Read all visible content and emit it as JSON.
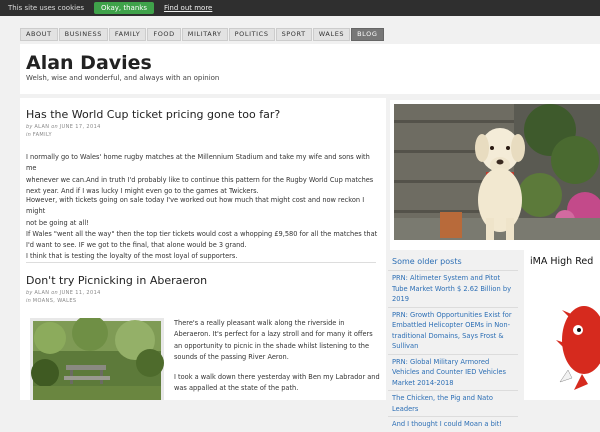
{
  "cookie_bar": {
    "message": "This site uses cookies",
    "ok_button": "Okay, thanks",
    "find_out_link": "Find out more"
  },
  "nav": {
    "items": [
      "ABOUT",
      "BUSINESS",
      "FAMILY",
      "FOOD",
      "MILITARY",
      "POLITICS",
      "SPORT",
      "WALES",
      "BLOG"
    ],
    "active": "BLOG"
  },
  "header": {
    "title": "Alan Davies",
    "tagline": "Welsh, wise and wonderful, and always with an opinion"
  },
  "posts": [
    {
      "title": "Has the World Cup ticket pricing gone too far?",
      "by": "by",
      "author": "ALAN",
      "on": "on",
      "date": "JUNE 17, 2014",
      "in": "in",
      "categories": "FAMILY",
      "paragraphs": [
        "I normally go to Wales' home rugby matches at the Millennium Stadium and take my wife and sons with me",
        "whenever we can.And in truth I'd probably like to continue this pattern for the Rugby World Cup matches",
        "next year. And if I was lucky I might even go to the games at Twickers.",
        "However, with tickets going on sale today I've worked out how much that might cost and now reckon I might",
        "not be going at all!",
        "If Wales \"went all the way\" then the top tier tickets would cost a whopping £9,580 for all the matches that",
        "I'd want to see. IF we got to the final, that alone would be 3 grand.",
        "I think that is testing the loyalty of the most loyal of supporters."
      ]
    },
    {
      "title": "Don't try Picnicking in Aberaeron",
      "by": "by",
      "author": "ALAN",
      "on": "on",
      "date": "JUNE 11, 2014",
      "in": "in",
      "categories": "MOANS, WALES",
      "paragraphs": [
        "There's a really pleasant walk along the riverside in",
        "Aberaeron. It's perfect for a lazy stroll and for many it offers",
        "an opportunity to picnic in the shade whilst listening to the",
        "sounds of the passing River Aeron.",
        "I took a walk down there yesterday with Ben my Labrador and",
        "was appalled at the state of the path."
      ]
    }
  ],
  "sidebar": {
    "heading": "Some older posts",
    "links": [
      "PRN: Altimeter System and Pitot Tube Market Worth $ 2.62 Billion by 2019",
      "PRN: Growth Opportunities Exist for Embattled Helicopter OEMs in Non-traditional Domains, Says Frost & Sullivan",
      "PRN: Global Military Armored Vehicles and Counter IED Vehicles Market 2014-2018",
      "The Chicken, the Pig and Nato Leaders",
      "And I thought I could Moan a bit!"
    ]
  },
  "sidebar2": {
    "title": "iMA High Red"
  },
  "colors": {
    "link": "#2d6fb5",
    "cookie_ok": "#3fa24a",
    "cookie_bar": "#2f2f2f"
  }
}
